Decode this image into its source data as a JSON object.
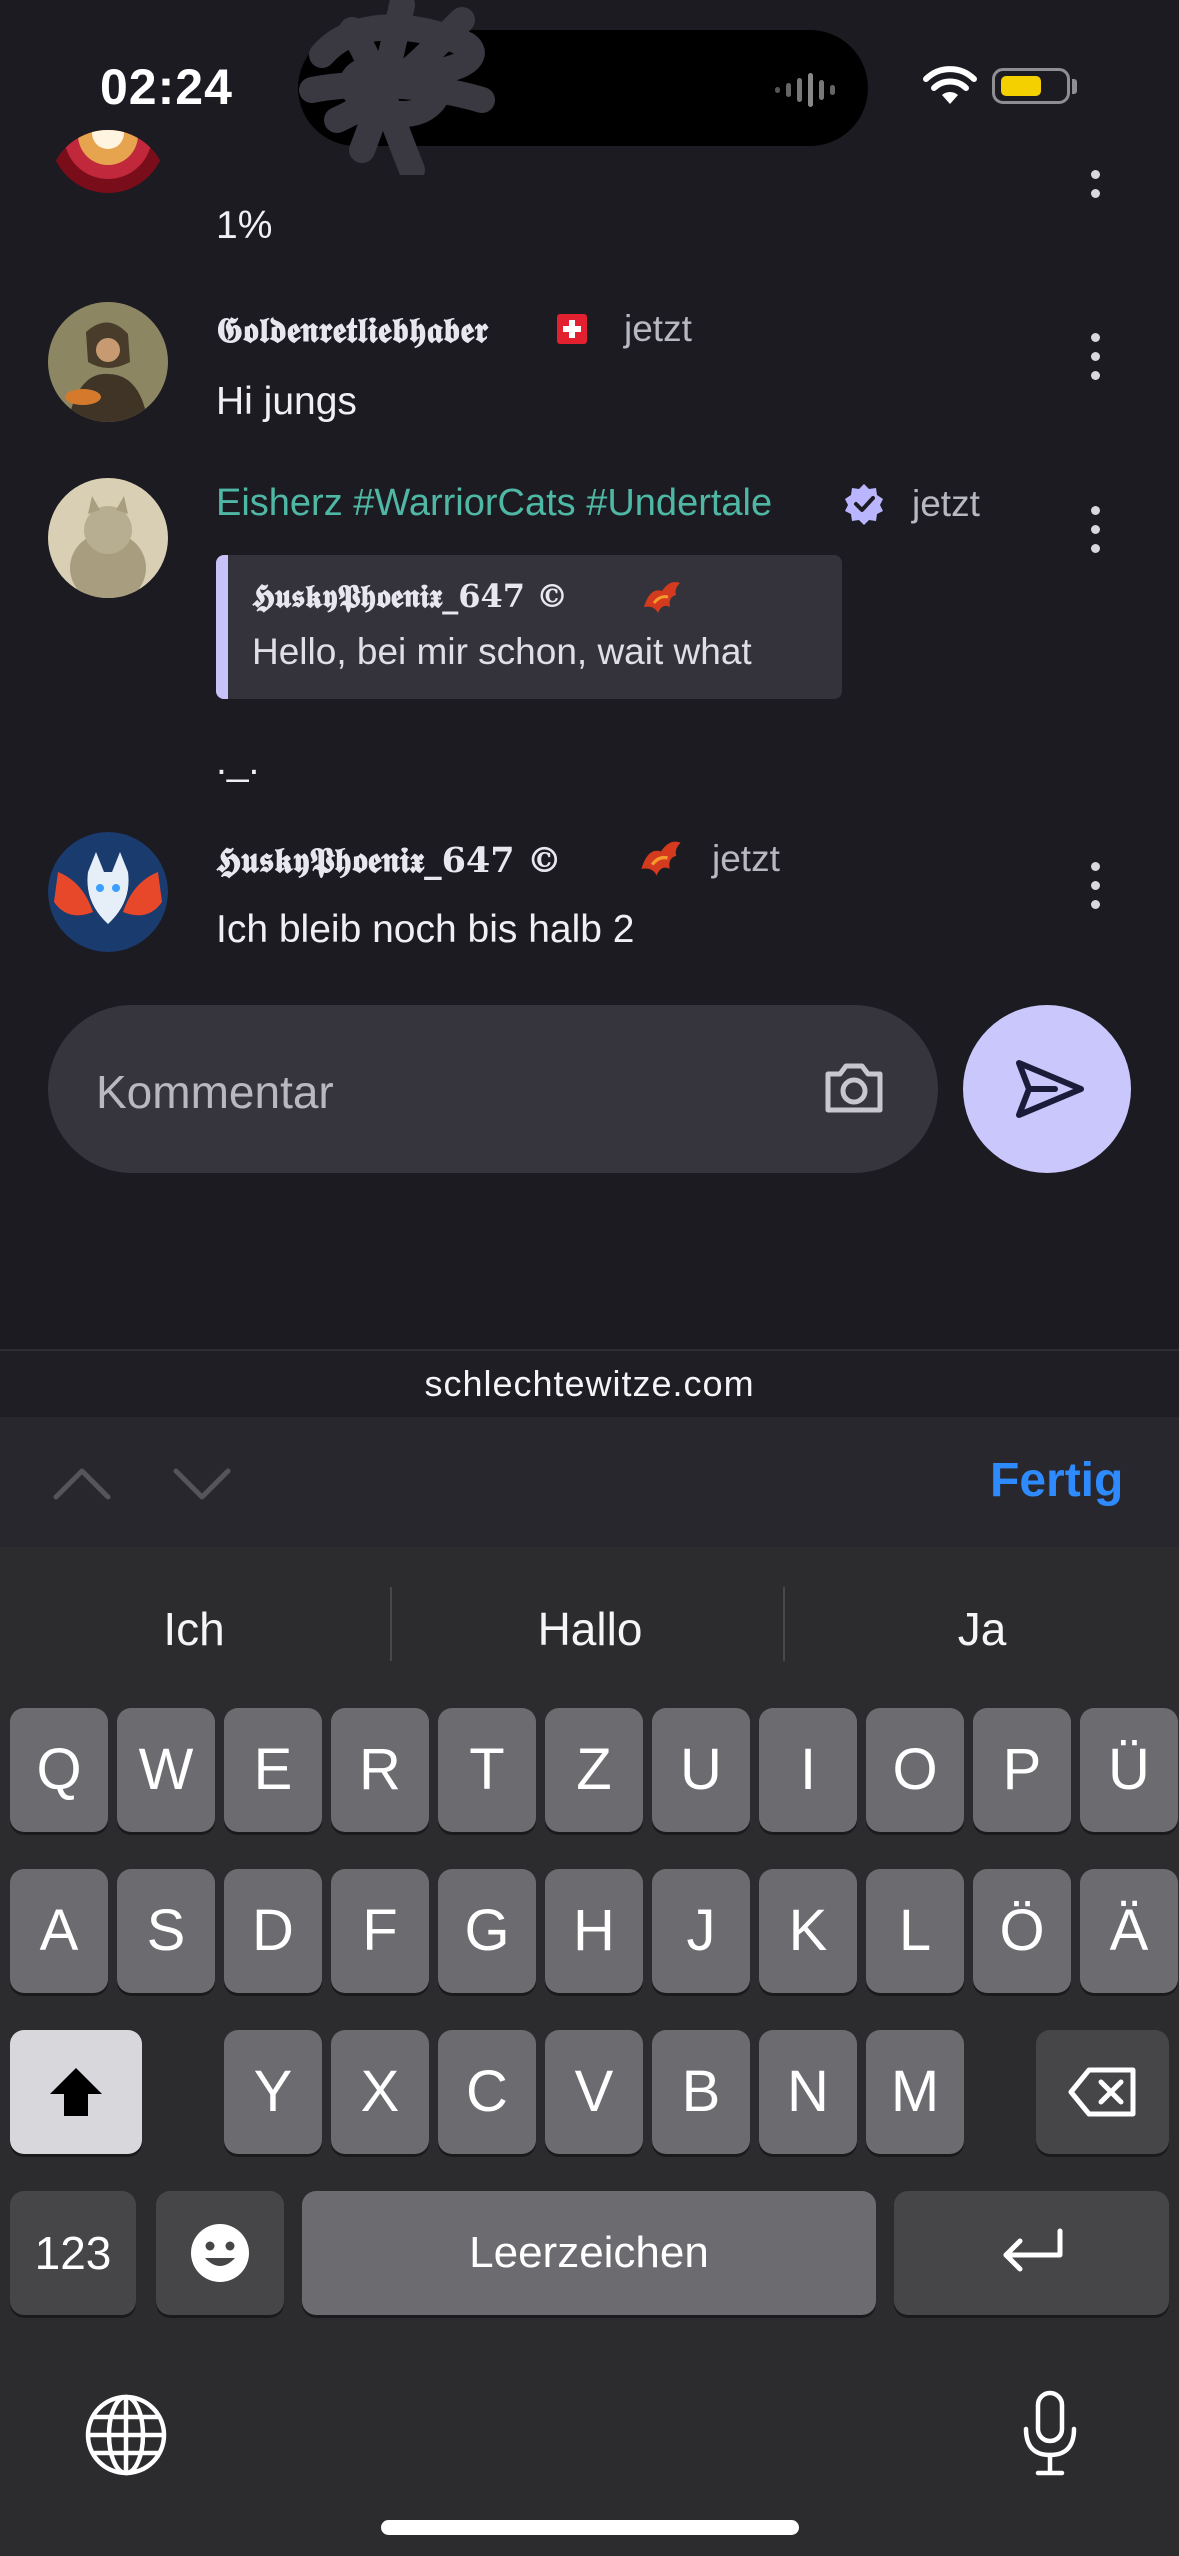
{
  "status_bar": {
    "time": "02:24"
  },
  "comments": [
    {
      "username": "",
      "timestamp": "",
      "text": "1%"
    },
    {
      "username": "𝕲𝖔𝖑𝖉𝖊𝖓𝖗𝖊𝖙𝖑𝖎𝖊𝖇𝖍𝖆𝖇𝖊𝖗",
      "flag": "🇨🇭",
      "timestamp": "jetzt",
      "text": "Hi jungs"
    },
    {
      "username": "Eisherz #WarriorCats #Undertale",
      "username_color": "#4fb8a5",
      "verified": true,
      "timestamp": "jetzt",
      "quote": {
        "username": "𝕳𝖚𝖘𝖐𝖞𝕻𝖍𝖔𝖊𝖓𝖎𝖝_647 ©",
        "text": "Hello, bei mir schon, wait what"
      },
      "text": "._."
    },
    {
      "username": "𝕳𝖚𝖘𝖐𝖞𝕻𝖍𝖔𝖊𝖓𝖎𝖝_647 ©",
      "timestamp": "jetzt",
      "text": "Ich bleib noch bis halb 2"
    }
  ],
  "comment_input": {
    "placeholder": "Kommentar"
  },
  "browser": {
    "url": "schlechtewitze.com"
  },
  "accessory_bar": {
    "done_label": "Fertig"
  },
  "keyboard": {
    "suggestions": [
      "Ich",
      "Hallo",
      "Ja"
    ],
    "row1": [
      "Q",
      "W",
      "E",
      "R",
      "T",
      "Z",
      "U",
      "I",
      "O",
      "P",
      "Ü"
    ],
    "row2": [
      "A",
      "S",
      "D",
      "F",
      "G",
      "H",
      "J",
      "K",
      "L",
      "Ö",
      "Ä"
    ],
    "row3": [
      "Y",
      "X",
      "C",
      "V",
      "B",
      "N",
      "M"
    ],
    "numbers_label": "123",
    "space_label": "Leerzeichen"
  },
  "colors": {
    "accent": "#c9c7fb",
    "done": "#2e8bff",
    "verified": "#b9b6ff"
  }
}
